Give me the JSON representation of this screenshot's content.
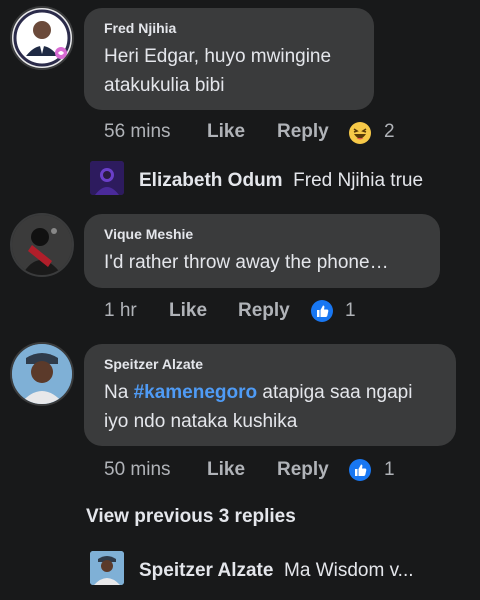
{
  "comments": [
    {
      "author": "Fred Njihia",
      "text": "Heri Edgar, huyo mwingine atakukulia bibi",
      "time": "56 mins",
      "like_label": "Like",
      "reply_label": "Reply",
      "reaction_icon": "haha-emoji-icon",
      "reaction_count": "2"
    },
    {
      "author": "Vique Meshie",
      "text": "I'd rather throw away the phone…",
      "time": "1 hr",
      "like_label": "Like",
      "reply_label": "Reply",
      "reaction_icon": "like-thumb-icon",
      "reaction_count": "1"
    },
    {
      "author": "Speitzer Alzate",
      "text_prefix": "Na ",
      "hashtag": "#kamenegoro",
      "text_suffix": " atapiga saa ngapi iyo ndo nataka kushika",
      "time": "50 mins",
      "like_label": "Like",
      "reply_label": "Reply",
      "reaction_icon": "like-thumb-icon",
      "reaction_count": "1"
    }
  ],
  "nested_replies": [
    {
      "author": "Elizabeth Odum",
      "text": "Fred Njihia true"
    },
    {
      "author": "Speitzer Alzate",
      "text": "Ma Wisdom v..."
    }
  ],
  "view_previous": "View previous 3 replies",
  "colors": {
    "background": "#18191a",
    "bubble": "#3a3b3c",
    "primary_text": "#e4e6eb",
    "secondary_text": "#b0b3b8",
    "link_blue": "#4f9bf5",
    "like_blue": "#1877f2",
    "haha_yellow": "#f7c948"
  }
}
